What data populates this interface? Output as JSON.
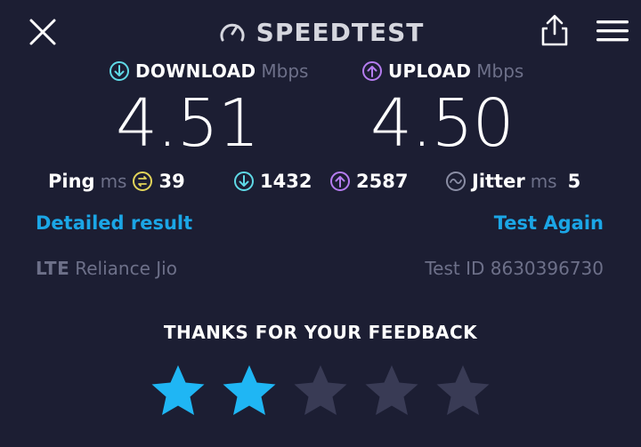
{
  "header": {
    "title": "SPEEDTEST",
    "close_icon": "close-icon",
    "share_icon": "share-icon",
    "menu_icon": "hamburger-menu-icon"
  },
  "download": {
    "label": "DOWNLOAD",
    "unit": "Mbps",
    "value": "4.51",
    "icon": "download-arrow-icon"
  },
  "upload": {
    "label": "UPLOAD",
    "unit": "Mbps",
    "value": "4.50",
    "icon": "upload-arrow-icon"
  },
  "ping": {
    "label": "Ping",
    "unit": "ms",
    "value": "39"
  },
  "download_latency": {
    "value": "1432"
  },
  "upload_latency": {
    "value": "2587"
  },
  "jitter": {
    "label": "Jitter",
    "unit": "ms",
    "value": "5"
  },
  "links": {
    "detailed": "Detailed result",
    "again": "Test Again"
  },
  "network": {
    "type": "LTE",
    "provider": "Reliance Jio"
  },
  "test_id": "Test ID 8630396730",
  "feedback": {
    "text": "THANKS FOR YOUR FEEDBACK",
    "rating": 2,
    "max": 5
  },
  "colors": {
    "background": "#1c1e33",
    "download": "#5fd9e6",
    "upload": "#b57cf0",
    "ping": "#e2d45a",
    "link": "#1ba6e6",
    "muted": "#6d7089",
    "star_active": "#1fb6f4",
    "star_inactive": "#393b55"
  }
}
